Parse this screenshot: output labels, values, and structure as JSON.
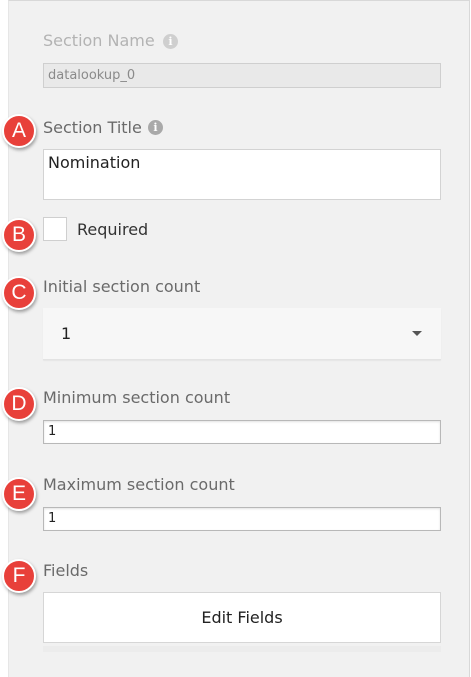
{
  "section_name": {
    "label": "Section Name",
    "info_icon": "i",
    "value": "datalookup_0"
  },
  "section_title": {
    "label": "Section Title",
    "info_icon": "i",
    "value": "Nomination"
  },
  "required": {
    "label": "Required",
    "checked": false
  },
  "initial_count": {
    "label": "Initial section count",
    "value": "1"
  },
  "minimum_count": {
    "label": "Minimum section count",
    "value": "1"
  },
  "maximum_count": {
    "label": "Maximum section count",
    "value": "1"
  },
  "fields": {
    "label": "Fields",
    "button": "Edit Fields"
  },
  "markers": [
    "A",
    "B",
    "C",
    "D",
    "E",
    "F"
  ],
  "colors": {
    "marker": "#e8403a",
    "panel": "#f1f1f1"
  }
}
